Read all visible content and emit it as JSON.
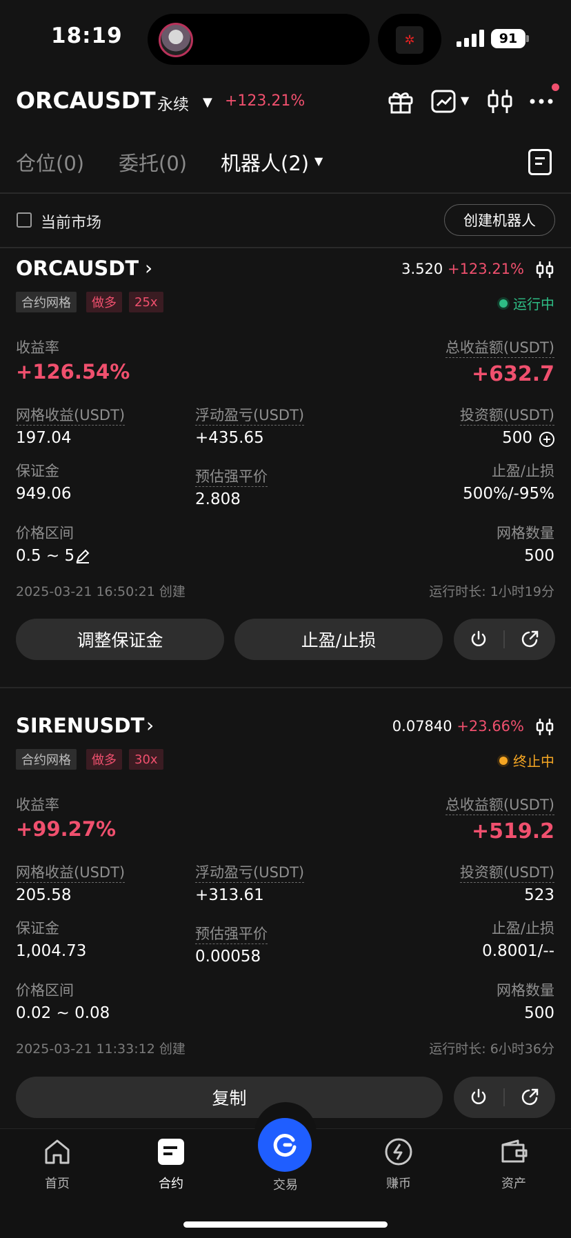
{
  "status_bar": {
    "time": "18:19",
    "battery": "91"
  },
  "header": {
    "symbol": "ORCAUSDT",
    "contract_type": "永续",
    "change": "+123.21%"
  },
  "tabs": [
    {
      "label": "仓位(0)",
      "active": false
    },
    {
      "label": "委托(0)",
      "active": false
    },
    {
      "label": "机器人(2)",
      "active": true
    }
  ],
  "filter": {
    "current_market_label": "当前市场",
    "create_bot_label": "创建机器人"
  },
  "bots": [
    {
      "symbol": "ORCAUSDT",
      "price": "3.520",
      "change": "+123.21%",
      "tags": [
        "合约网格",
        "做多",
        "25x"
      ],
      "status": "运行中",
      "status_color": "#2ebd85",
      "roi_label": "收益率",
      "roi": "+126.54%",
      "total_profit_label": "总收益额(USDT)",
      "total_profit": "+632.7",
      "grid_profit_label": "网格收益(USDT)",
      "grid_profit": "197.04",
      "floating_pnl_label": "浮动盈亏(USDT)",
      "floating_pnl": "+435.65",
      "investment_label": "投资额(USDT)",
      "investment": "500",
      "margin_label": "保证金",
      "margin": "949.06",
      "liq_label": "预估强平价",
      "liq_price": "2.808",
      "tpsl_label": "止盈/止损",
      "tpsl": "500%/-95%",
      "range_label": "价格区间",
      "range": "0.5 ~ 5",
      "grid_count_label": "网格数量",
      "grid_count": "500",
      "created": "2025-03-21 16:50:21 创建",
      "runtime": "运行时长: 1小时19分",
      "buttons": [
        "调整保证金",
        "止盈/止损"
      ]
    },
    {
      "symbol": "SIRENUSDT",
      "price": "0.07840",
      "change": "+23.66%",
      "tags": [
        "合约网格",
        "做多",
        "30x"
      ],
      "status": "终止中",
      "status_color": "#f5a623",
      "roi_label": "收益率",
      "roi": "+99.27%",
      "total_profit_label": "总收益额(USDT)",
      "total_profit": "+519.2",
      "grid_profit_label": "网格收益(USDT)",
      "grid_profit": "205.58",
      "floating_pnl_label": "浮动盈亏(USDT)",
      "floating_pnl": "+313.61",
      "investment_label": "投资额(USDT)",
      "investment": "523",
      "margin_label": "保证金",
      "margin": "1,004.73",
      "liq_label": "预估强平价",
      "liq_price": "0.00058",
      "tpsl_label": "止盈/止损",
      "tpsl": "0.8001/--",
      "range_label": "价格区间",
      "range": "0.02 ~ 0.08",
      "grid_count_label": "网格数量",
      "grid_count": "500",
      "created": "2025-03-21 11:33:12 创建",
      "runtime": "运行时长: 6小时36分",
      "buttons": [
        "复制"
      ]
    }
  ],
  "bottom_nav": [
    {
      "label": "首页",
      "icon": "home-icon"
    },
    {
      "label": "合约",
      "icon": "contract-icon",
      "active": true
    },
    {
      "label": "交易",
      "icon": "trade-icon"
    },
    {
      "label": "赚币",
      "icon": "earn-icon"
    },
    {
      "label": "资产",
      "icon": "wallet-icon"
    }
  ]
}
